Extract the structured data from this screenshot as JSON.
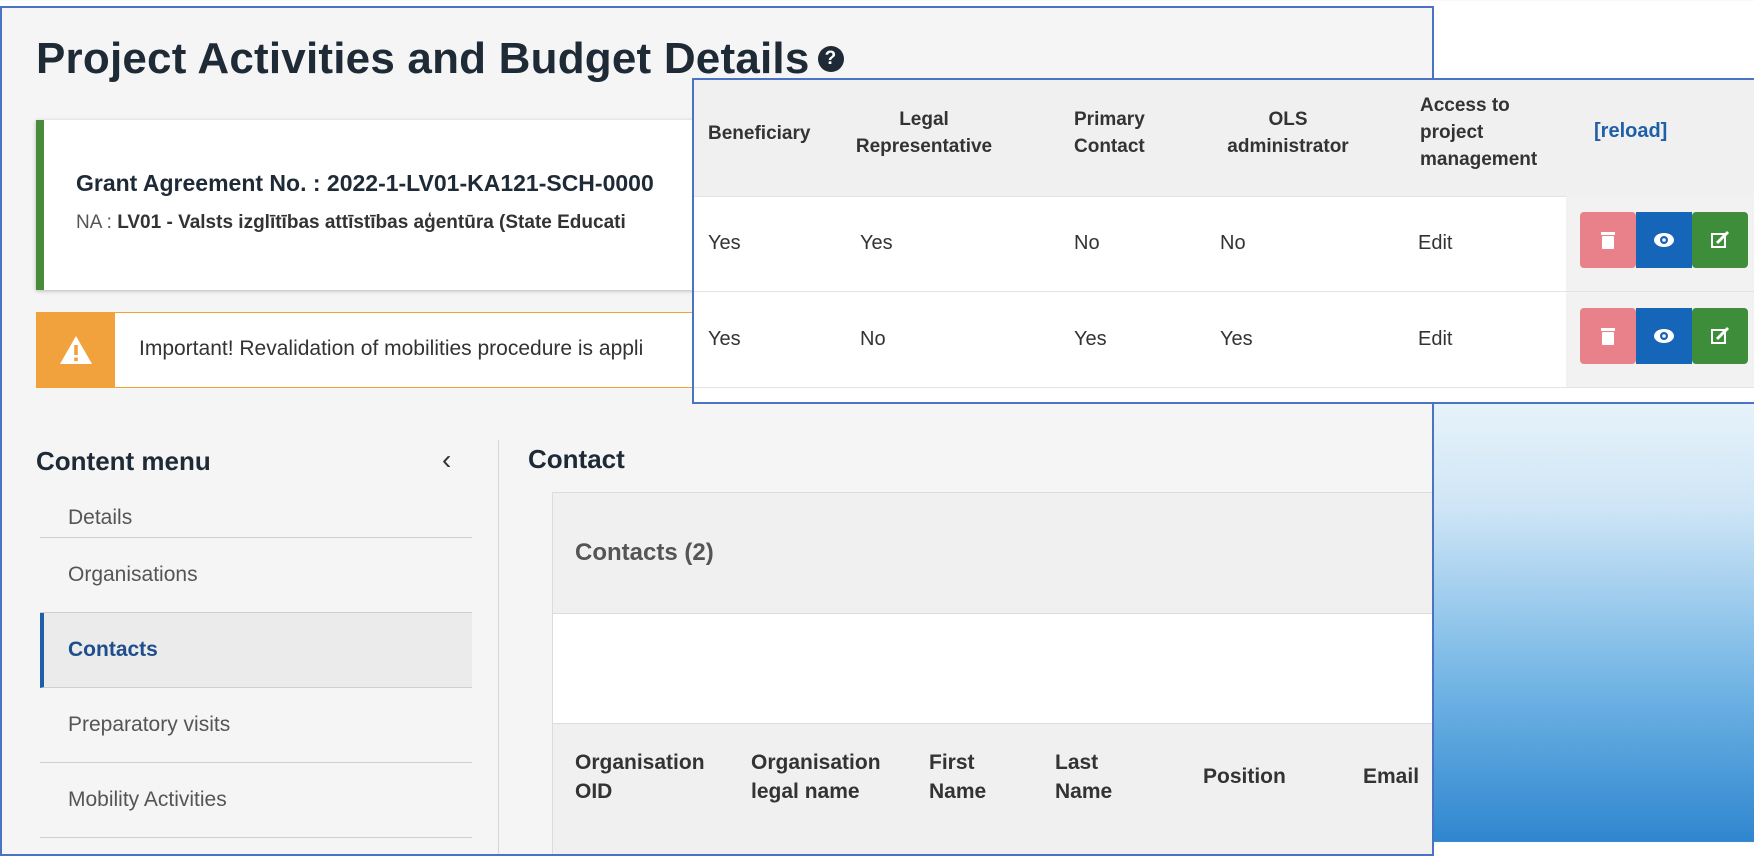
{
  "page": {
    "title": "Project Activities and Budget Details",
    "help_icon": "question-circle-icon"
  },
  "grant": {
    "label": "Grant Agreement No. : 2022-1-LV01-KA121-SCH-0000",
    "na_prefix": "NA : ",
    "na_value": "LV01 - Valsts izglītības attīstības aģentūra (State Educati"
  },
  "warning": {
    "icon": "warning-triangle-icon",
    "color": "#f2a23c",
    "text": "Important! Revalidation of mobilities procedure is appli"
  },
  "content_menu": {
    "title": "Content menu",
    "collapse_icon": "chevron-left-icon",
    "items": [
      {
        "label": "Details"
      },
      {
        "label": "Organisations"
      },
      {
        "label": "Contacts"
      },
      {
        "label": "Preparatory visits"
      },
      {
        "label": "Mobility Activities"
      }
    ],
    "active_color": "#1f5ea8"
  },
  "contact_section": {
    "title": "Contact",
    "card_title": "Contacts (2)",
    "columns": [
      "Organisation OID",
      "Organisation legal name",
      "First Name",
      "Last Name",
      "Position",
      "Email"
    ]
  },
  "overlay": {
    "headers": [
      "Beneficiary",
      "Legal Representative",
      "Primary Contact",
      "OLS administrator",
      "Access to project management"
    ],
    "reload_label": "[reload]",
    "rows": [
      {
        "beneficiary": "Yes",
        "legal_rep": "Yes",
        "primary_contact": "No",
        "ols_admin": "No",
        "access": "Edit"
      },
      {
        "beneficiary": "Yes",
        "legal_rep": "No",
        "primary_contact": "Yes",
        "ols_admin": "Yes",
        "access": "Edit"
      }
    ],
    "action_icons": [
      "trash-icon",
      "eye-icon",
      "edit-icon"
    ],
    "action_colors": {
      "delete": "#e8818a",
      "view": "#1565b8",
      "edit": "#3e8d3b"
    }
  }
}
